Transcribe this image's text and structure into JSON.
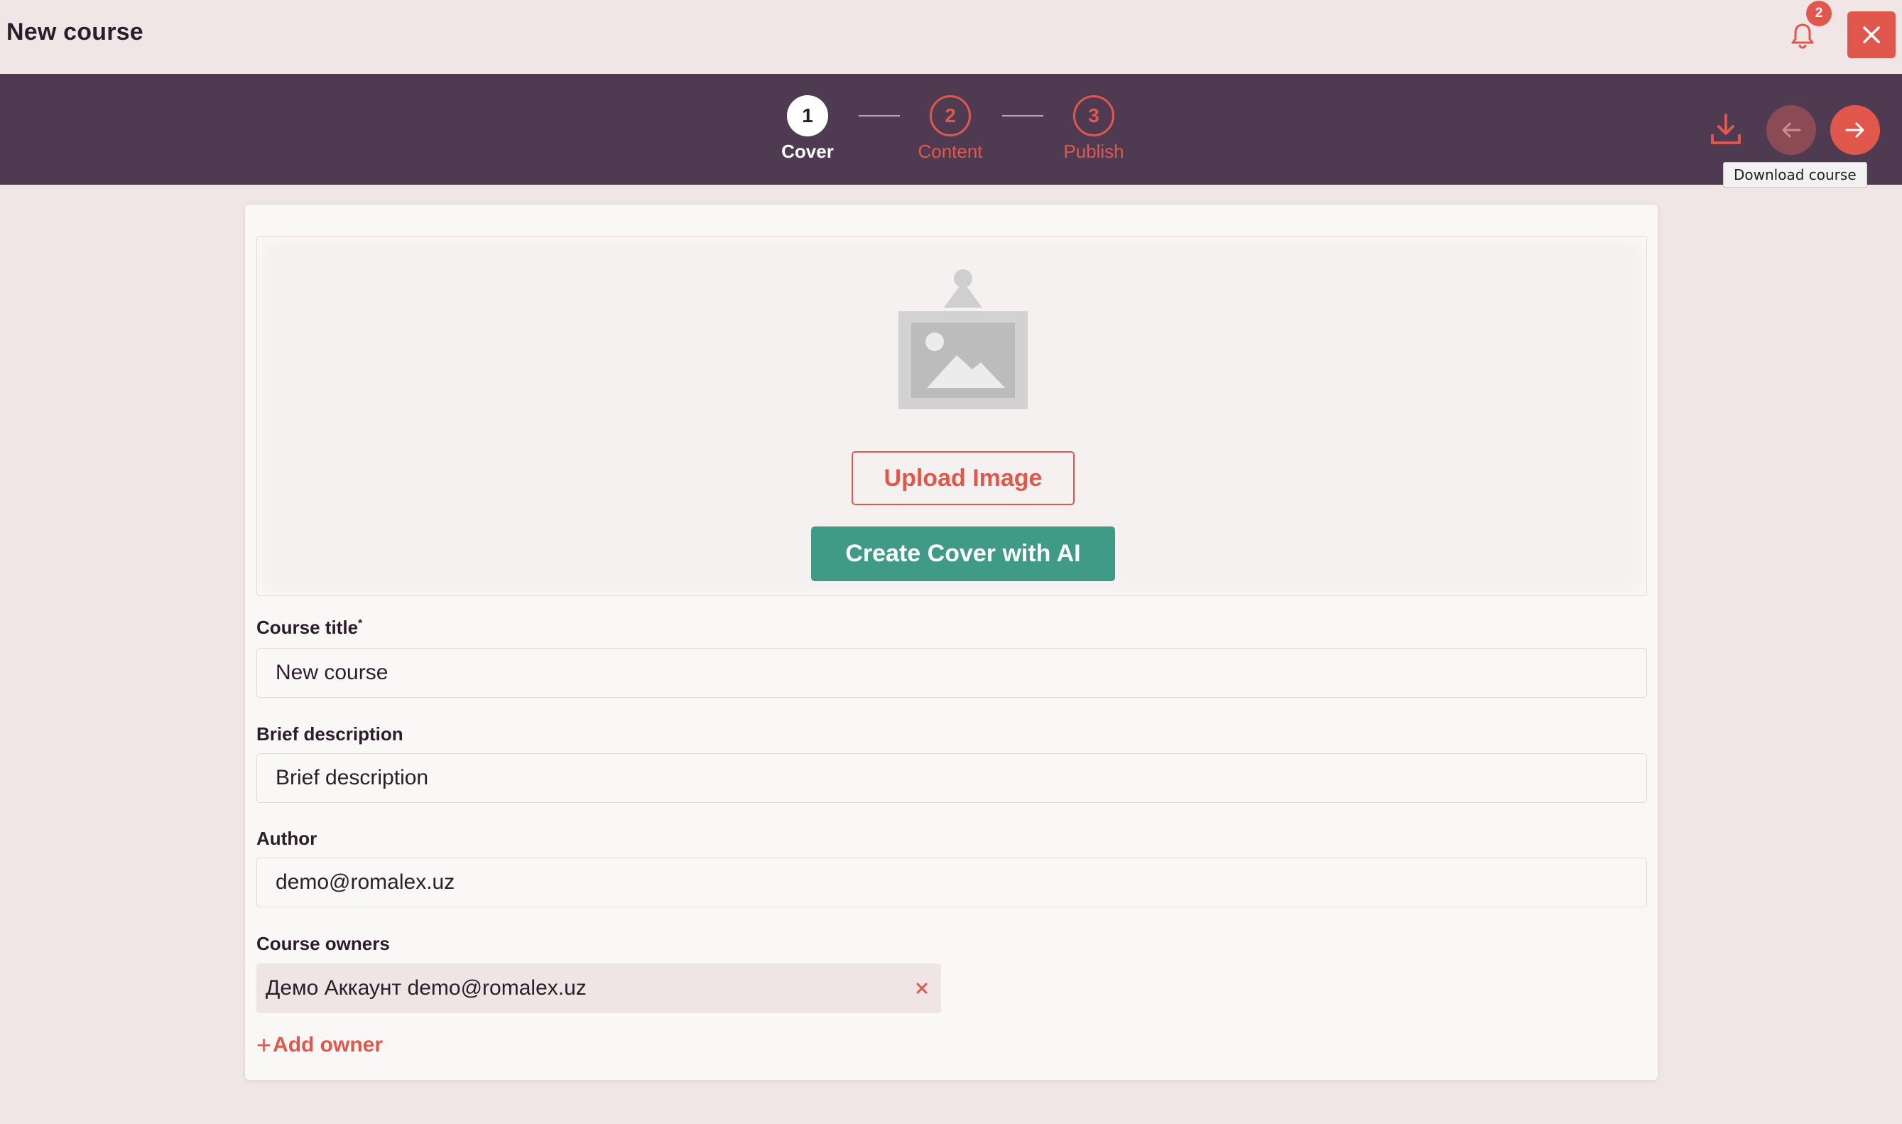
{
  "header": {
    "title": "New course",
    "notification_count": "2",
    "accent_color": "#e2574c"
  },
  "stepper": {
    "steps": [
      {
        "number": "1",
        "label": "Cover",
        "state": "active"
      },
      {
        "number": "2",
        "label": "Content",
        "state": "pending"
      },
      {
        "number": "3",
        "label": "Publish",
        "state": "pending"
      }
    ],
    "band_color": "#4f3b51",
    "download_tooltip": "Download course"
  },
  "cover": {
    "upload_label": "Upload Image",
    "ai_label": "Create Cover with AI",
    "ai_color": "#3f9b88"
  },
  "form": {
    "title_label": "Course title",
    "required_mark": "*",
    "title_value": "New course",
    "description_label": "Brief description",
    "description_placeholder": "Brief description",
    "author_label": "Author",
    "author_value": "demo@romalex.uz",
    "owners_label": "Course owners",
    "owners": [
      {
        "text": "Демо Аккаунт demo@romalex.uz"
      }
    ],
    "add_owner_label": "Add owner",
    "add_owner_plus": "+"
  },
  "icons": {
    "notification": "bell-icon",
    "close": "close-icon",
    "download": "download-icon",
    "prev": "arrow-left-icon",
    "next": "arrow-right-icon",
    "cover_placeholder": "image-placeholder-icon",
    "chip_remove": "x-icon"
  }
}
